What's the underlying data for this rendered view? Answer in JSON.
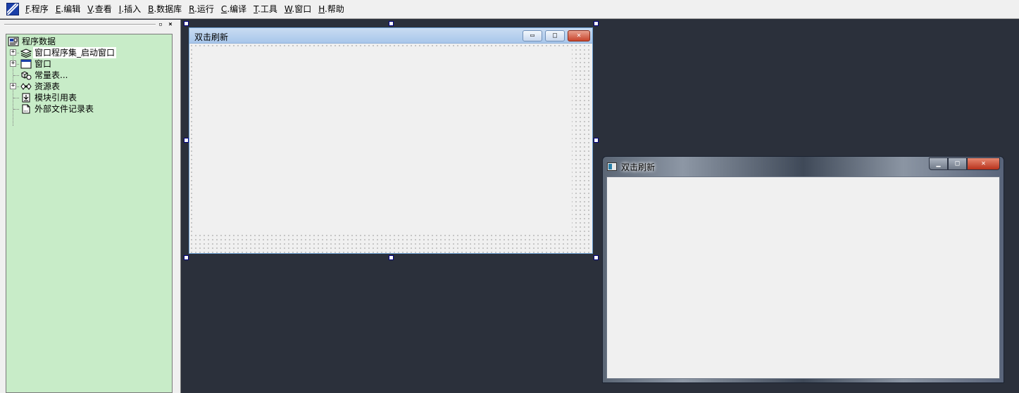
{
  "menu": [
    {
      "mnemonic": "F",
      "label": ".程序"
    },
    {
      "mnemonic": "E",
      "label": ".编辑"
    },
    {
      "mnemonic": "V",
      "label": ".查看"
    },
    {
      "mnemonic": "I",
      "label": ".插入"
    },
    {
      "mnemonic": "B",
      "label": ".数据库"
    },
    {
      "mnemonic": "R",
      "label": ".运行"
    },
    {
      "mnemonic": "C",
      "label": ".编译"
    },
    {
      "mnemonic": "T",
      "label": ".工具"
    },
    {
      "mnemonic": "W",
      "label": ".窗口"
    },
    {
      "mnemonic": "H",
      "label": ".帮助"
    }
  ],
  "tree": {
    "root": {
      "label": "程序数据",
      "icon": "program-data-icon"
    },
    "items": [
      {
        "label": "窗口程序集_启动窗口",
        "icon": "stack-icon",
        "expander": "+"
      },
      {
        "label": "窗口",
        "icon": "window-icon",
        "expander": "+"
      },
      {
        "label": "常量表...",
        "icon": "constants-icon",
        "expander": ""
      },
      {
        "label": "资源表",
        "icon": "resources-icon",
        "expander": "+"
      },
      {
        "label": "模块引用表",
        "icon": "module-icon",
        "expander": ""
      },
      {
        "label": "外部文件记录表",
        "icon": "file-icon",
        "expander": ""
      }
    ]
  },
  "design_window": {
    "title": "双击刷新",
    "min": "▭",
    "max": "□",
    "close": "✕"
  },
  "preview_window": {
    "title": "双击刷新",
    "min": "▁",
    "max": "□",
    "close": "✕"
  },
  "colors": {
    "tree_bg": "#c8ecc8",
    "desktop_bg": "#2b303b"
  }
}
